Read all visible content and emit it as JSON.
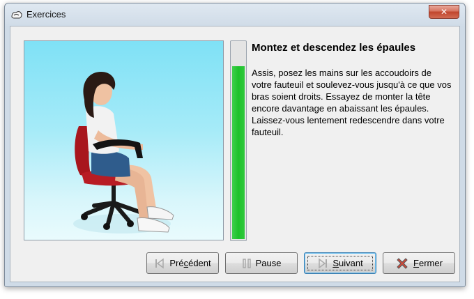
{
  "window": {
    "title": "Exercices",
    "close_label": "✕"
  },
  "instruction": {
    "title": "Montez et descendez les épaules",
    "body": "Assis, posez les mains sur les accoudoirs de votre fauteuil et soulevez-vous jusqu'à ce que vos bras soient droits. Essayez de monter la tête encore davantage en abaissant les épaules. Laissez-vous lentement redescendre dans votre fauteuil."
  },
  "progress": {
    "fraction": 0.88,
    "color": "#1ec22b"
  },
  "buttons": {
    "previous": {
      "pre": "Pré",
      "mnemonic": "c",
      "post": "édent",
      "icon": "skip-back-icon"
    },
    "pause": {
      "pre": "",
      "mnemonic": "",
      "post": "Pause",
      "icon": "pause-icon"
    },
    "next": {
      "pre": "",
      "mnemonic": "S",
      "post": "uivant",
      "icon": "skip-forward-icon"
    },
    "close": {
      "pre": "",
      "mnemonic": "F",
      "post": "ermer",
      "icon": "red-x-icon"
    }
  }
}
